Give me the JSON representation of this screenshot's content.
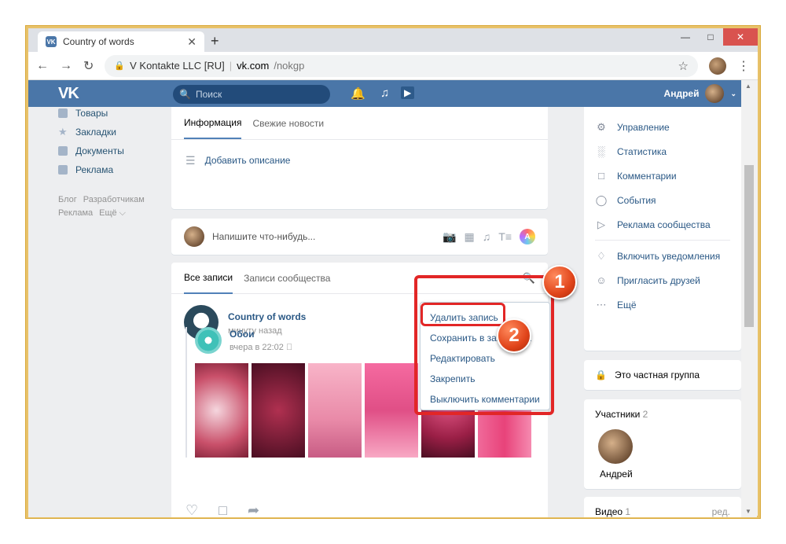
{
  "browser": {
    "tab_title": "Country of words",
    "favicon": "VK",
    "close_tab": "✕",
    "new_tab": "+",
    "site_label": "V Kontakte LLC [RU]",
    "url_host": "vk.com",
    "url_path": "/nokgp"
  },
  "vk_header": {
    "logo": "VK",
    "search_placeholder": "Поиск",
    "user_name": "Андрей",
    "accent": "#4a76a8"
  },
  "left_nav": {
    "items": [
      {
        "label": "Товары",
        "icon": "bag-icon"
      },
      {
        "label": "Закладки",
        "icon": "star-icon"
      },
      {
        "label": "Документы",
        "icon": "document-icon"
      },
      {
        "label": "Реклама",
        "icon": "megaphone-icon"
      }
    ],
    "footer": [
      "Блог",
      "Разработчикам",
      "Реклама",
      "Ещё ⌵"
    ]
  },
  "info_card": {
    "tabs": [
      "Информация",
      "Свежие новости"
    ],
    "add_description": "Добавить описание"
  },
  "composer": {
    "placeholder": "Напишите что-нибудь...",
    "badge": "A"
  },
  "posts_card": {
    "tabs": [
      "Все записи",
      "Записи сообщества"
    ]
  },
  "post": {
    "author": "Country of words",
    "time": "минуту назад",
    "repost": {
      "author": "Обои",
      "time": "вчера в 22:02 "
    },
    "photo_colors": [
      "#c9506a",
      "#7a1f3a",
      "#e98aa8",
      "#e04f86",
      "#9a1f46",
      "#f06a9a"
    ]
  },
  "dropdown": {
    "items": [
      "Удалить запись",
      "Сохранить в закладках",
      "Редактировать",
      "Закрепить",
      "Выключить комментарии"
    ]
  },
  "right_menu": {
    "items": [
      {
        "label": "Управление",
        "icon": "gear-icon"
      },
      {
        "label": "Статистика",
        "icon": "stats-icon"
      },
      {
        "label": "Комментарии",
        "icon": "comment-icon"
      },
      {
        "label": "События",
        "icon": "event-icon"
      },
      {
        "label": "Реклама сообщества",
        "icon": "megaphone-icon"
      }
    ],
    "items2": [
      {
        "label": "Включить уведомления",
        "icon": "bell-icon"
      },
      {
        "label": "Пригласить друзей",
        "icon": "person-add-icon"
      },
      {
        "label": "Ещё",
        "icon": "more-icon"
      }
    ]
  },
  "private_group": "Это частная группа",
  "members": {
    "title": "Участники",
    "count": "2",
    "name": "Андрей"
  },
  "videos": {
    "title": "Видео",
    "count": "1",
    "edit": "ред."
  },
  "annotations": {
    "step1": "1",
    "step2": "2",
    "highlight_color": "#e22626"
  }
}
